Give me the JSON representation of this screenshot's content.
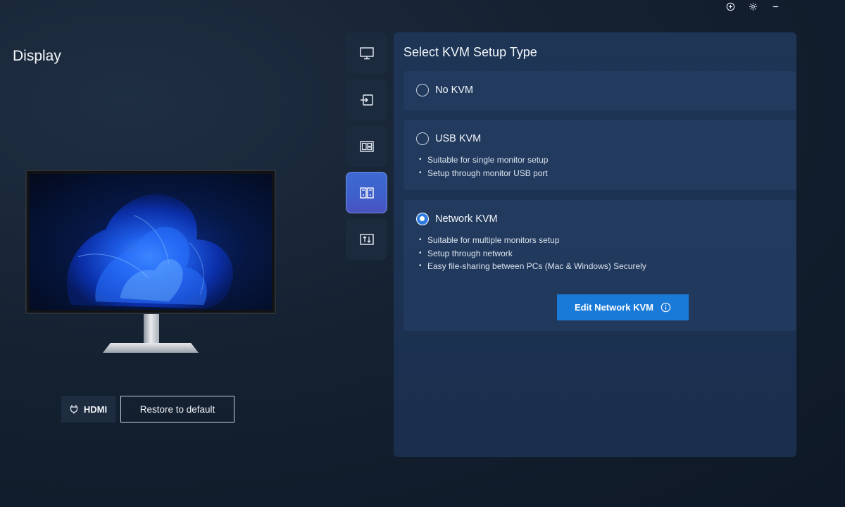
{
  "window": {
    "controls": [
      "add-icon",
      "gear-icon",
      "minimize-icon"
    ]
  },
  "page": {
    "title": "Display"
  },
  "device": {
    "input_label": "HDMI",
    "restore_label": "Restore to default"
  },
  "tabs": [
    {
      "icon": "monitor-icon",
      "active": false
    },
    {
      "icon": "input-source-icon",
      "active": false
    },
    {
      "icon": "layout-icon",
      "active": false
    },
    {
      "icon": "kvm-icon",
      "active": true
    },
    {
      "icon": "adjust-icon",
      "active": false
    }
  ],
  "kvm": {
    "title": "Select KVM Setup Type",
    "options": [
      {
        "label": "No KVM",
        "selected": false,
        "bullets": []
      },
      {
        "label": "USB KVM",
        "selected": false,
        "bullets": [
          "Suitable for single monitor setup",
          "Setup through monitor USB port"
        ]
      },
      {
        "label": "Network KVM",
        "selected": true,
        "bullets": [
          "Suitable for multiple monitors setup",
          "Setup through network",
          "Easy file-sharing between PCs (Mac & Windows) Securely"
        ]
      }
    ],
    "edit_label": "Edit Network KVM"
  },
  "colors": {
    "accent": "#1a7ad8",
    "active_tab": "#3f5fca",
    "panel": "#1e3556"
  }
}
